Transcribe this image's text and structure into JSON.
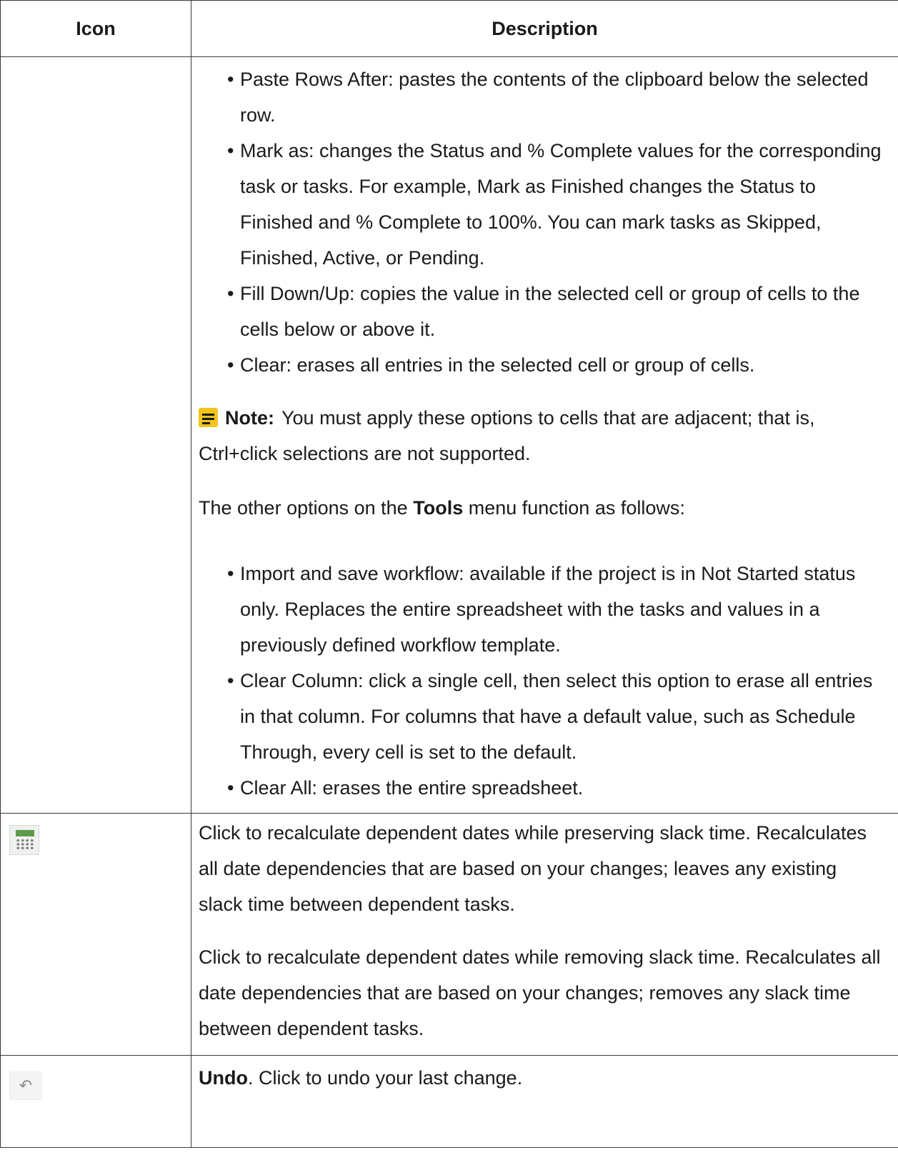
{
  "header": {
    "icon": "Icon",
    "description": "Description"
  },
  "row1": {
    "list1": [
      "Paste Rows After: pastes the contents of the clipboard below the selected row.",
      "Mark as: changes the Status and % Complete values for the corresponding task or tasks. For example, Mark as Finished changes the Status to Finished and % Complete to 100%. You can mark tasks as Skipped, Finished, Active, or Pending.",
      "Fill Down/Up: copies the value in the selected cell or group of cells to the cells below or above it.",
      "Clear: erases all entries in the selected cell or group of cells."
    ],
    "note": {
      "icon": "note-icon",
      "label": "Note:",
      "text": "You must apply these options to cells that are adjacent; that is, Ctrl+click selections are not supported."
    },
    "tools_para": {
      "before": "The other options on the ",
      "bold": "Tools",
      "after": " menu function as follows:"
    },
    "list2": [
      "Import and save workflow: available if the project is in Not Started status only. Replaces the entire spreadsheet with the tasks and values in a previously defined workflow template.",
      "Clear Column: click a single cell, then select this option to erase all entries in that column. For columns that have a default value, such as Schedule Through, every cell is set to the default.",
      "Clear All: erases the entire spreadsheet."
    ]
  },
  "row2": {
    "icon": "calculator-icon",
    "p1": "Click to recalculate dependent dates while preserving slack time. Recalculates all date dependencies that are based on your changes; leaves any existing slack time between dependent tasks.",
    "p2": "Click to recalculate dependent dates while removing slack time. Recalculates all date dependencies that are based on your changes; removes any slack time between dependent tasks."
  },
  "row3": {
    "icon": "undo-icon",
    "bold": "Undo",
    "text": ". Click to undo your last change."
  }
}
